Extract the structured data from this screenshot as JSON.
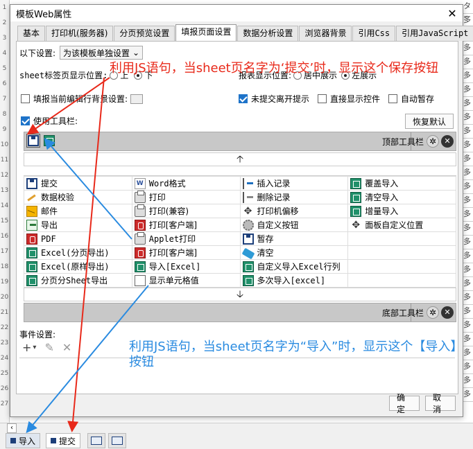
{
  "dialog": {
    "title": "模板Web属性",
    "tabs": [
      {
        "label": "基本"
      },
      {
        "label": "打印机(服务器)"
      },
      {
        "label": "分页预览设置"
      },
      {
        "label": "填报页面设置"
      },
      {
        "label": "数据分析设置"
      },
      {
        "label": "浏览器背景"
      },
      {
        "label": "引用Css"
      },
      {
        "label": "引用JavaScript"
      }
    ],
    "active_tab": "填报页面设置"
  },
  "settings": {
    "scope_label": "以下设置:",
    "scope_value": "为该模板单独设置",
    "sheet_label_pos_label": "sheet标签页显示位置:",
    "sheet_pos_top": "上",
    "sheet_pos_bottom": "下",
    "report_pos_label": "报表显示位置:",
    "report_pos_center": "居中展示",
    "report_pos_left": "左展示",
    "fill_row_bg": "填报当前编辑行背景设置:",
    "unsubmitted_leave_hint": "未提交离开提示",
    "direct_show_controls": "直接显示控件",
    "auto_save": "自动暂存",
    "use_toolbar": "使用工具栏:",
    "restore_default": "恢复默认"
  },
  "top_toolbar": {
    "label": "顶部工具栏"
  },
  "bottom_toolbar": {
    "label": "底部工具栏"
  },
  "buttons_grid": [
    [
      {
        "icon": "save-icon",
        "label": "提交"
      },
      {
        "icon": "word-icon",
        "label": "Word格式"
      },
      {
        "icon": "insert-record-icon",
        "label": "插入记录"
      },
      {
        "icon": "excel-icon",
        "label": "覆盖导入"
      }
    ],
    [
      {
        "icon": "check-icon",
        "label": "数据校验"
      },
      {
        "icon": "print-icon",
        "label": "打印"
      },
      {
        "icon": "delete-record-icon",
        "label": "删除记录"
      },
      {
        "icon": "excel-icon",
        "label": "清空导入"
      }
    ],
    [
      {
        "icon": "mail-icon",
        "label": "邮件"
      },
      {
        "icon": "print-icon",
        "label": "打印(兼容)"
      },
      {
        "icon": "move-icon",
        "label": "打印机偏移"
      },
      {
        "icon": "excel-icon",
        "label": "增量导入"
      }
    ],
    [
      {
        "icon": "export-icon",
        "label": "导出"
      },
      {
        "icon": "pdf-icon",
        "label": "打印[客户端]"
      },
      {
        "icon": "gear-icon",
        "label": "自定义按钮"
      },
      {
        "icon": "move-icon",
        "label": "面板自定义位置"
      }
    ],
    [
      {
        "icon": "pdf-icon",
        "label": "PDF"
      },
      {
        "icon": "print-icon",
        "label": "Applet打印"
      },
      {
        "icon": "save-icon",
        "label": "暂存"
      },
      {
        "icon": "",
        "label": ""
      }
    ],
    [
      {
        "icon": "excel-icon",
        "label": "Excel(分页导出)"
      },
      {
        "icon": "pdf-icon",
        "label": "打印[客户端]"
      },
      {
        "icon": "clear-icon",
        "label": "清空"
      },
      {
        "icon": "",
        "label": ""
      }
    ],
    [
      {
        "icon": "excel-icon",
        "label": "Excel(原样导出)"
      },
      {
        "icon": "excel-icon",
        "label": "导入[Excel]"
      },
      {
        "icon": "excel-icon",
        "label": "自定义导入Excel行列"
      },
      {
        "icon": "",
        "label": ""
      }
    ],
    [
      {
        "icon": "excel-icon",
        "label": "分页分Sheet导出"
      },
      {
        "icon": "blank-icon",
        "label": "显示单元格值"
      },
      {
        "icon": "excel-icon",
        "label": "多次导入[excel]"
      },
      {
        "icon": "",
        "label": ""
      }
    ]
  ],
  "events": {
    "label": "事件设置:",
    "add": "+",
    "edit": "✎",
    "remove": "✕"
  },
  "footer": {
    "ok": "确定",
    "cancel": "取消"
  },
  "sheet_tabs": [
    {
      "label": "导入"
    },
    {
      "label": "提交"
    }
  ],
  "annotations": {
    "red": "利用JS语句，当sheet页名字为‘提交’时，显示这个保存按钮",
    "blue": "利用JS语句，当sheet页名字为“导入”时，显示这个【导入】按钮"
  },
  "colors": {
    "red_annotation": "#e8291a",
    "blue_annotation": "#2a8be0"
  }
}
